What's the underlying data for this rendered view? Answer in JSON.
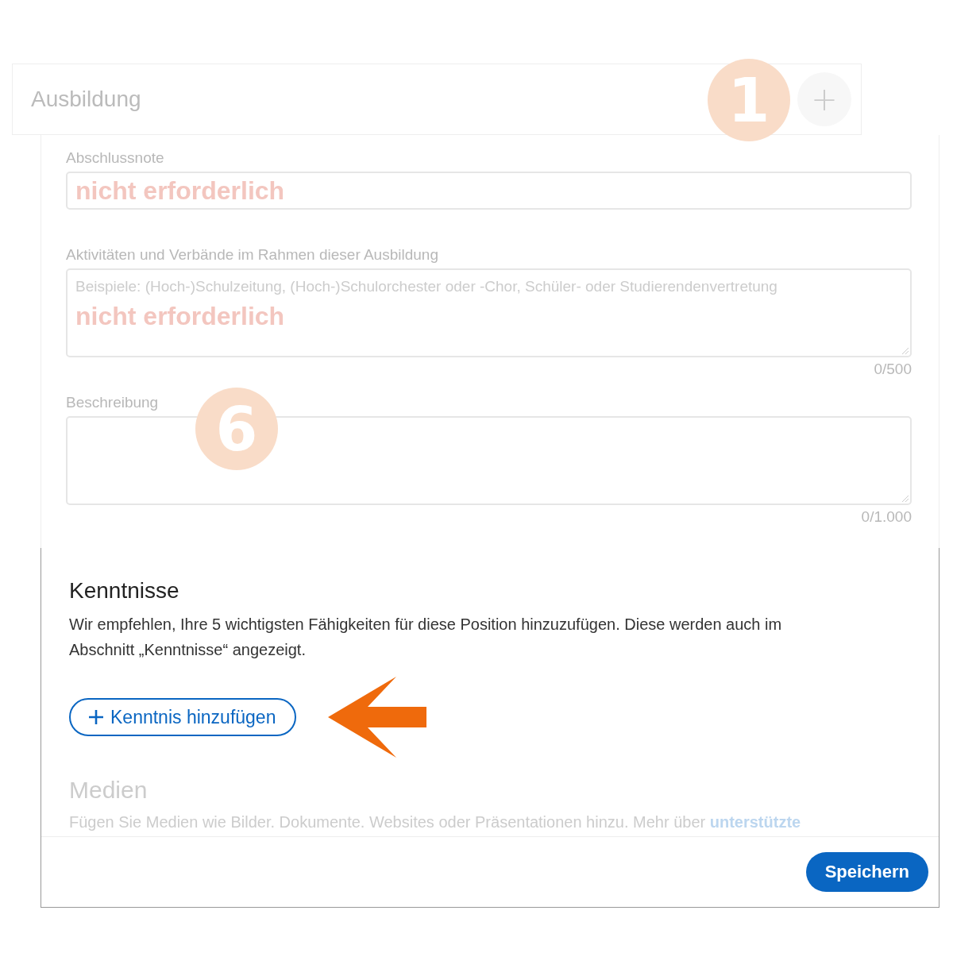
{
  "header": {
    "title": "Ausbildung",
    "add_button": "+"
  },
  "fields": [
    {
      "kind": "input",
      "label": "Abschlussnote",
      "value": "nicht erforderlich"
    },
    {
      "kind": "textarea",
      "label": "Aktivitäten und Verbände im Rahmen dieser Ausbildung",
      "placeholder": "Beispiele: (Hoch-)Schulzeitung, (Hoch-)Schulorchester oder -Chor, Schüler- oder Studierendenvertretung",
      "value": "nicht erforderlich",
      "counter": "0/500"
    },
    {
      "kind": "textarea",
      "label": "Beschreibung",
      "counter": "0/1.000"
    }
  ],
  "skills": {
    "title": "Kenntnisse",
    "text": "Wir empfehlen, Ihre 5 wichtigsten Fähigkeiten für diese Position hinzuzufügen. Diese werden auch im Abschnitt „Kenntnisse“ angezeigt.",
    "button": "Kenntnis hinzufügen"
  },
  "media": {
    "title": "Medien",
    "text": "Fügen Sie Medien wie Bilder. Dokumente. Websites oder Präsentationen hinzu. Mehr über",
    "link": "unterstützte"
  },
  "save_button": "Speichern",
  "annotations": [
    {
      "label": "1"
    },
    {
      "label": "6"
    }
  ]
}
